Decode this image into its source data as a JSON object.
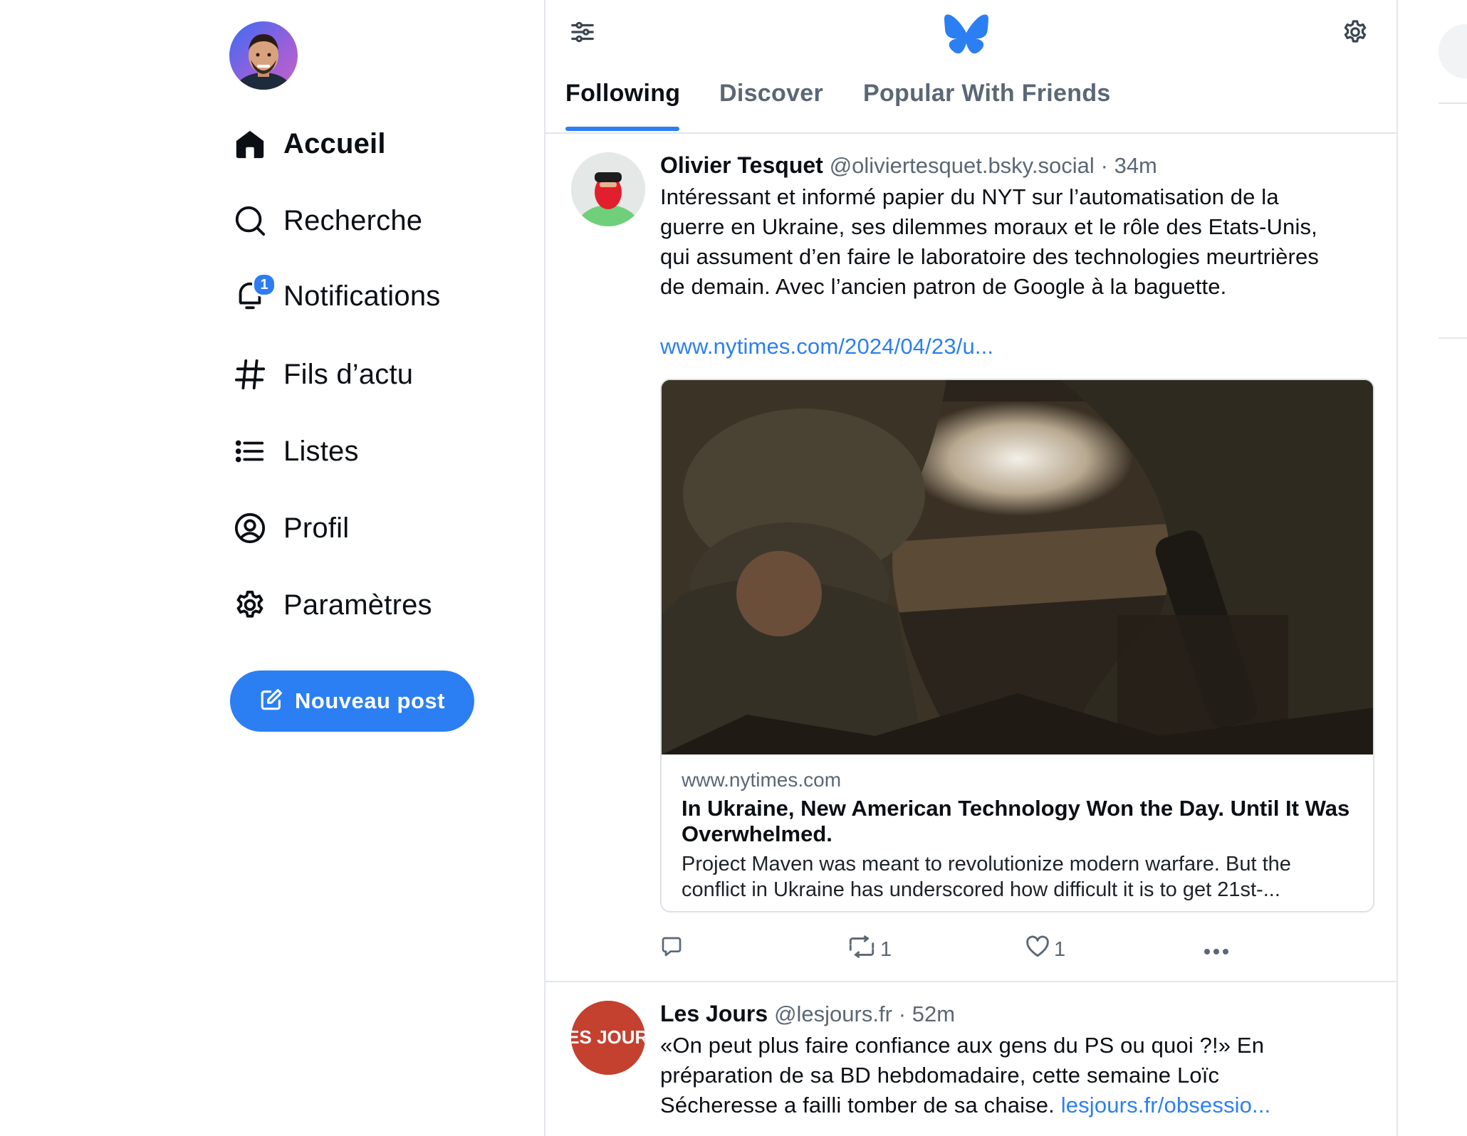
{
  "nav": {
    "items": [
      {
        "label": "Accueil",
        "icon": "home-icon",
        "active": true
      },
      {
        "label": "Recherche",
        "icon": "search-icon"
      },
      {
        "label": "Notifications",
        "icon": "bell-icon",
        "badge": "1"
      },
      {
        "label": "Fils d’actu",
        "icon": "hash-icon"
      },
      {
        "label": "Listes",
        "icon": "list-icon"
      },
      {
        "label": "Profil",
        "icon": "profile-icon"
      },
      {
        "label": "Paramètres",
        "icon": "gear-icon"
      }
    ],
    "new_post_label": "Nouveau post"
  },
  "header": {
    "tabs": [
      {
        "label": "Following",
        "active": true
      },
      {
        "label": "Discover"
      },
      {
        "label": "Popular With Friends"
      }
    ]
  },
  "posts": [
    {
      "author": "Olivier Tesquet",
      "handle": "@oliviertesquet.bsky.social",
      "time": "34m",
      "lines": [
        "Intéressant et informé papier du NYT sur l’automatisation de la",
        "guerre en Ukraine, ses dilemmes moraux et le rôle des Etats-Unis,",
        "qui assument d’en faire le laboratoire des technologies meurtrières",
        "de demain. Avec l’ancien patron de Google à la baguette."
      ],
      "link": "www.nytimes.com/2024/04/23/u...",
      "card": {
        "domain": "www.nytimes.com",
        "title": "In Ukraine, New American Technology Won the Day. Until It Was Overwhelmed.",
        "desc_lines": [
          "Project Maven was meant to revolutionize modern warfare. But the",
          "conflict in Ukraine has underscored how difficult it is to get 21st-..."
        ]
      },
      "reposts": "1",
      "likes": "1"
    },
    {
      "author": "Les Jours",
      "handle": "@lesjours.fr",
      "time": "52m",
      "avatar_text": "LES JOURS",
      "lines": [
        "«On peut plus faire confiance aux gens du PS ou quoi ?!» En",
        "préparation de sa BD hebdomadaire, cette semaine Loïc"
      ],
      "last_line_text": "Sécheresse a failli tomber de sa chaise.",
      "link": "lesjours.fr/obsessio..."
    }
  ],
  "colors": {
    "accent": "#2b7ff3",
    "muted": "#5b6775",
    "border": "#e3e6ea",
    "les_jours_red": "#c4402f"
  }
}
